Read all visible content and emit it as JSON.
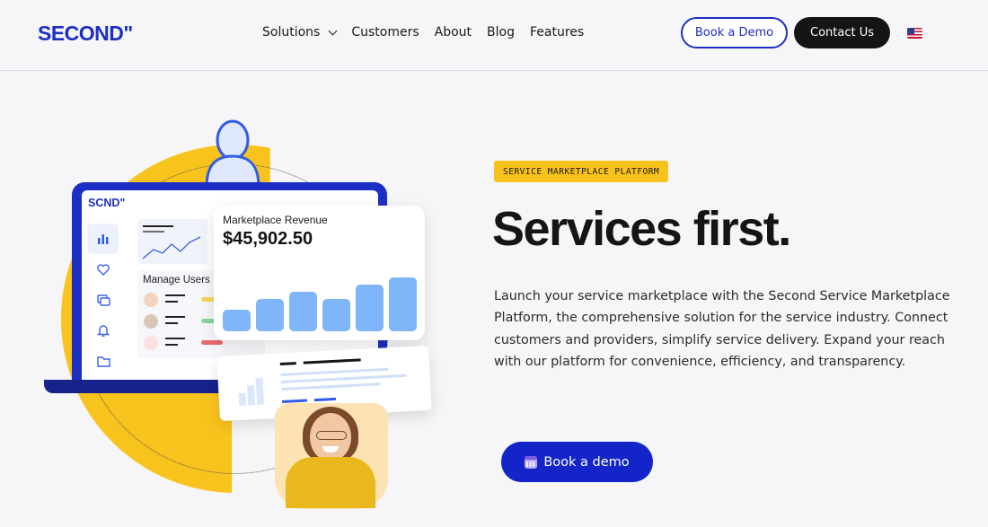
{
  "header": {
    "logo": "SECOND\"",
    "nav": [
      {
        "label": "Solutions",
        "has_dropdown": true
      },
      {
        "label": "Customers"
      },
      {
        "label": "About"
      },
      {
        "label": "Blog"
      },
      {
        "label": "Features"
      }
    ],
    "book_demo_label": "Book a Demo",
    "contact_label": "Contact Us",
    "language_icon": "us-flag-icon"
  },
  "hero": {
    "badge": "SERVICE MARKETPLACE PLATFORM",
    "title": "Services first.",
    "description": "Launch your service marketplace with the Second Service Marketplace Platform, the comprehensive solution for the service industry. Connect customers and providers, simplify service delivery. Expand your reach with our platform for convenience, efficiency, and transparency.",
    "cta_label": "Book a demo",
    "cta_icon": "calendar-icon"
  },
  "illustration": {
    "dashboard_logo": "SCND\"",
    "manage_users_label": "Manage Users",
    "revenue_label": "Marketplace Revenue",
    "revenue_value": "$45,902.50",
    "revenue_bars": [
      0.3,
      0.45,
      0.55,
      0.45,
      0.65,
      0.75
    ],
    "colors": {
      "brand": "#1c2fc4",
      "accent": "#f9c31e",
      "bar": "#7fb6f9"
    }
  }
}
